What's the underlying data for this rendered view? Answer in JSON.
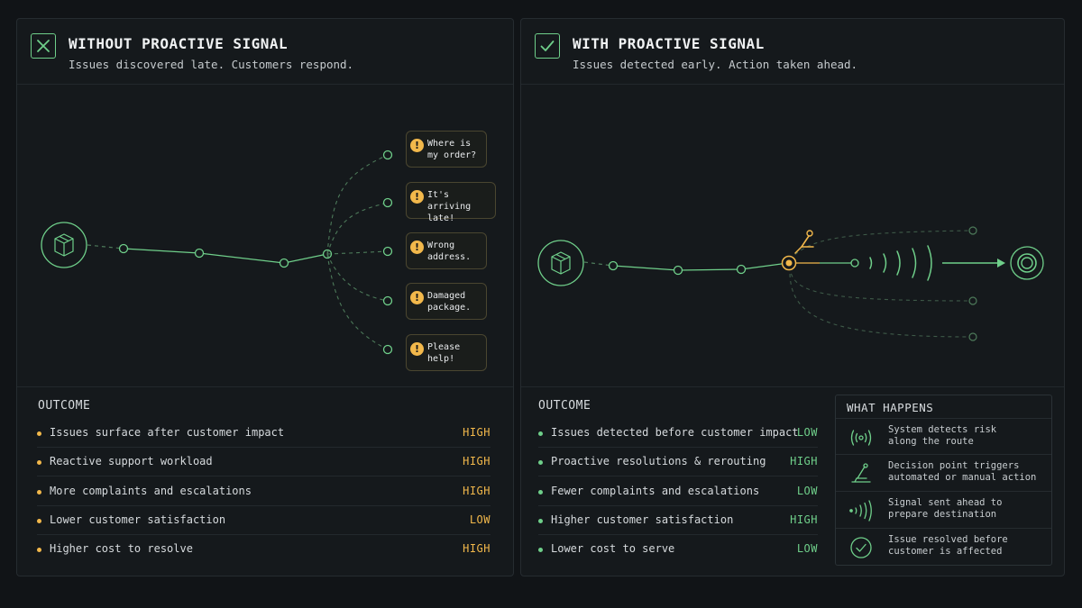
{
  "colors": {
    "green": "#6fcf8a",
    "amber": "#f2b84b",
    "dim": "#4d7a5a"
  },
  "left": {
    "title": "WITHOUT PROACTIVE SIGNAL",
    "subtitle": "Issues discovered late. Customers respond.",
    "icon": "x-icon",
    "bubbles": [
      {
        "text": "Where is my order?"
      },
      {
        "text": "It's arriving late!"
      },
      {
        "text": "Wrong address."
      },
      {
        "text": "Damaged package."
      },
      {
        "text": "Please help!"
      }
    ],
    "outcome_title": "OUTCOME",
    "outcomes": [
      {
        "label": "Issues surface after customer impact",
        "level": "HIGH"
      },
      {
        "label": "Reactive support workload",
        "level": "HIGH"
      },
      {
        "label": "More complaints and escalations",
        "level": "HIGH"
      },
      {
        "label": "Lower customer satisfaction",
        "level": "LOW"
      },
      {
        "label": "Higher cost to resolve",
        "level": "HIGH"
      }
    ]
  },
  "right": {
    "title": "WITH PROACTIVE SIGNAL",
    "subtitle": "Issues detected early. Action taken ahead.",
    "icon": "check-icon",
    "outcome_title": "OUTCOME",
    "outcomes": [
      {
        "label": "Issues detected before customer impact",
        "level": "LOW"
      },
      {
        "label": "Proactive resolutions & rerouting",
        "level": "HIGH"
      },
      {
        "label": "Fewer complaints and escalations",
        "level": "LOW"
      },
      {
        "label": "Higher customer satisfaction",
        "level": "HIGH"
      },
      {
        "label": "Lower cost to serve",
        "level": "LOW"
      }
    ],
    "what_happens": {
      "title": "WHAT HAPPENS",
      "items": [
        {
          "icon": "radar-icon",
          "text": "System detects risk\nalong the route"
        },
        {
          "icon": "lever-icon",
          "text": "Decision point triggers\nautomated or manual action"
        },
        {
          "icon": "signal-waves-icon",
          "text": "Signal sent ahead to\nprepare destination"
        },
        {
          "icon": "check-circle-icon",
          "text": "Issue resolved before\ncustomer is affected"
        }
      ]
    }
  }
}
